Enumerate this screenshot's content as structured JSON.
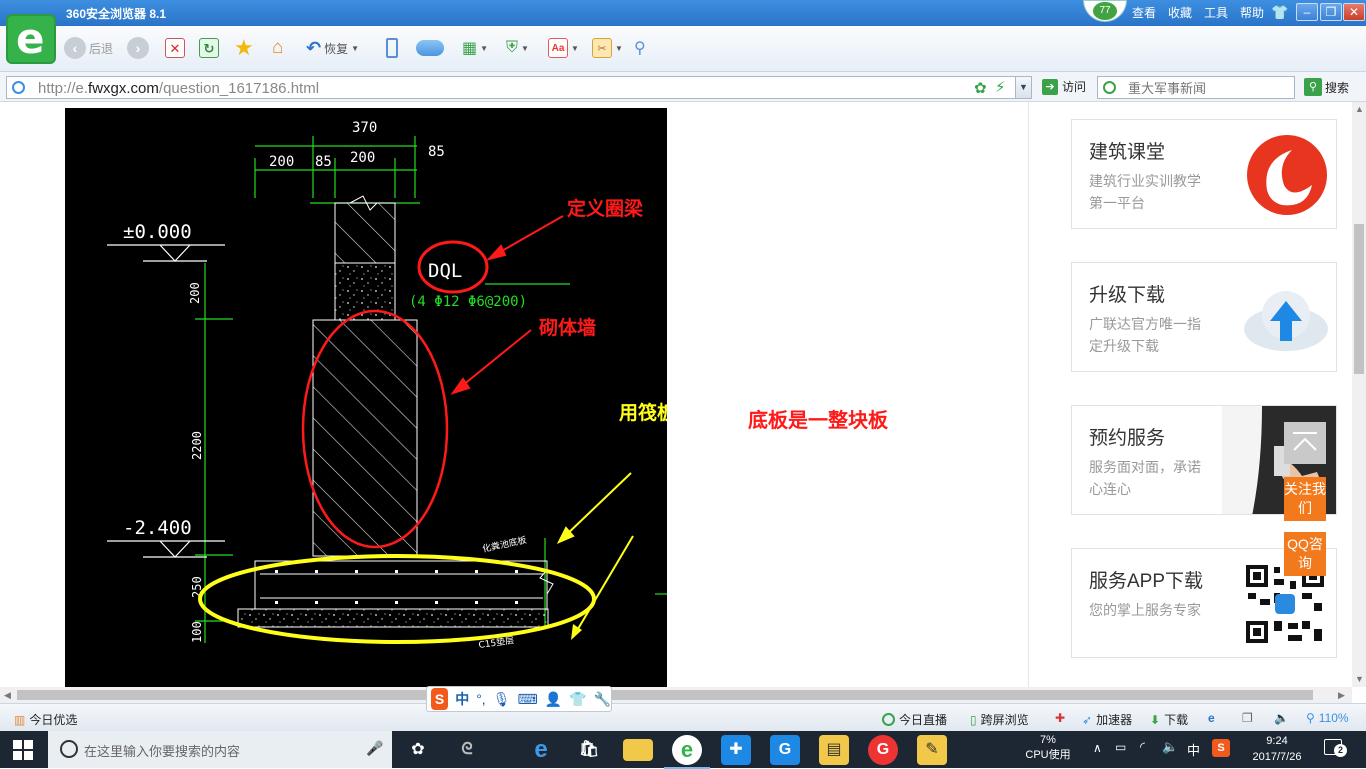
{
  "browser": {
    "title": "360安全浏览器 8.1",
    "badge": "77",
    "menus": [
      "查看",
      "收藏",
      "工具",
      "帮助"
    ],
    "toolbar": {
      "back_label": "后退",
      "restore_label": "恢复"
    },
    "address": {
      "url_prefix": "http://e.",
      "url_domain": "fwxgx.com",
      "url_path": "/question_1617186.html",
      "visit_label": "访问"
    },
    "search": {
      "placeholder": "重大军事新闻",
      "button_label": "搜索"
    }
  },
  "drawing": {
    "dims_top": [
      "370",
      "200",
      "85",
      "200",
      "85"
    ],
    "elev_top": "±0.000",
    "elev_bottom": "-2.400",
    "dims_left": [
      "200",
      "2200",
      "250",
      "100"
    ],
    "beam_label": "DQL",
    "beam_spec": "(4 Φ12  Φ6@200)",
    "small_label_1": "化粪池底板",
    "small_label_2": "C15垫层",
    "annotations": {
      "ring_beam": "定义圈梁",
      "masonry_wall": "砌体墙",
      "raft_slab": "用筏板定义",
      "whole_slab": "底板是一整块板"
    }
  },
  "sidebar": {
    "cards": [
      {
        "title": "建筑课堂",
        "desc": "建筑行业实训教学第一平台"
      },
      {
        "title": "升级下载",
        "desc": "广联达官方唯一指定升级下载"
      },
      {
        "title": "预约服务",
        "desc": "服务面对面，承诺心连心"
      },
      {
        "title": "服务APP下载",
        "desc": "您的掌上服务专家"
      }
    ],
    "follow_label": "关注我们",
    "qq_label": "QQ咨询"
  },
  "statusbar": {
    "left": "今日优选",
    "live": "今日直播",
    "cross_screen": "跨屏浏览",
    "accelerator": "加速器",
    "download": "下载",
    "zoom": "110%"
  },
  "ime": {
    "mode": "中"
  },
  "taskbar": {
    "search_placeholder": "在这里输入你要搜索的内容",
    "cpu_percent": "7%",
    "cpu_label": "CPU使用",
    "ime_indicator": "中",
    "time": "9:24",
    "date": "2017/7/26",
    "notifications": "2"
  },
  "colors": {
    "accent_blue": "#2a74c9",
    "green": "#3aa34a",
    "orange": "#f27a1c",
    "annot_red": "#ff1a1a",
    "annot_yellow": "#ffff1a",
    "cad_green": "#22dd22"
  }
}
